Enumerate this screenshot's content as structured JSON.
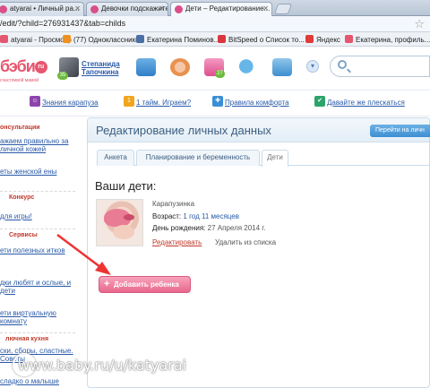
{
  "browser": {
    "tabs": [
      {
        "label": "atyarai • Личный ра..."
      },
      {
        "label": "Девочки подскажите к..."
      },
      {
        "label": "Дети – Редактирование..."
      }
    ],
    "url": "/edit/?child=276931437&tab=childs",
    "bookmarks": [
      {
        "label": "atyarai - Просмотр",
        "color": "#e5566f"
      },
      {
        "label": "(77) Одноклассники",
        "color": "#f0901e"
      },
      {
        "label": "Екатерина Поминов...",
        "color": "#4a6fa5"
      },
      {
        "label": "BitSpeed о Список то...",
        "color": "#d9363e"
      },
      {
        "label": "Яндекс",
        "color": "#e03a3a"
      },
      {
        "label": "Екатерина, профиль...",
        "color": "#e5566f"
      }
    ]
  },
  "site": {
    "logo": "бэби",
    "logo_suffix": "ru",
    "tagline": "счастливой мамой",
    "user_first": "Степанида",
    "user_last": "Тапочкина",
    "avatar_badge": "35",
    "header_badge": "27"
  },
  "subnav": [
    {
      "label": "Знания карапуза",
      "color": "#8e44ad"
    },
    {
      "label": "1 тайм. Играем?",
      "color": "#f1a51e"
    },
    {
      "label": "Правила комфорта",
      "color": "#3a8fd6"
    },
    {
      "label": "Давайте же плескаться",
      "color": "#2ca36b"
    }
  ],
  "sidebar": {
    "sections": [
      {
        "title": "онсультации"
      },
      {
        "title": "Конкурс"
      },
      {
        "title": "Сервисы"
      },
      {
        "title": "лючная кухня"
      }
    ],
    "links": [
      {
        "label": "ажаем правильно за личной кожей"
      },
      {
        "label": "еты женской ены"
      },
      {
        "label": "для игры!"
      },
      {
        "label": "ети полезных итков"
      },
      {
        "label": "дки любят и ослые, и дети"
      },
      {
        "label": "ети виртуальную комнату"
      },
      {
        "label": "ски, сборы, сластные. Советы"
      },
      {
        "label": "сладко о малыше"
      }
    ]
  },
  "main": {
    "title": "Редактирование личных данных",
    "goto_label": "Перейти на личн",
    "tabs": [
      {
        "label": "Анкета"
      },
      {
        "label": "Планирование и беременность"
      },
      {
        "label": "Дети"
      }
    ],
    "kids_heading": "Ваши дети:",
    "child": {
      "name": "Карапузинка",
      "age_label": "Возраст:",
      "age_value": "1 год 11 месяцев",
      "birthday_label": "День рождения:",
      "birthday_value": "27 Апреля 2014 г.",
      "edit_label": "Редактировать",
      "delete_label": "Удалить из списка"
    },
    "add_child_label": "Добавить ребенка"
  },
  "watermark": "www.baby.ru/u/katyarai",
  "colors": {
    "brand_pink": "#e5566f",
    "link_blue": "#2a5aa8",
    "accent_red": "#c0392b"
  }
}
